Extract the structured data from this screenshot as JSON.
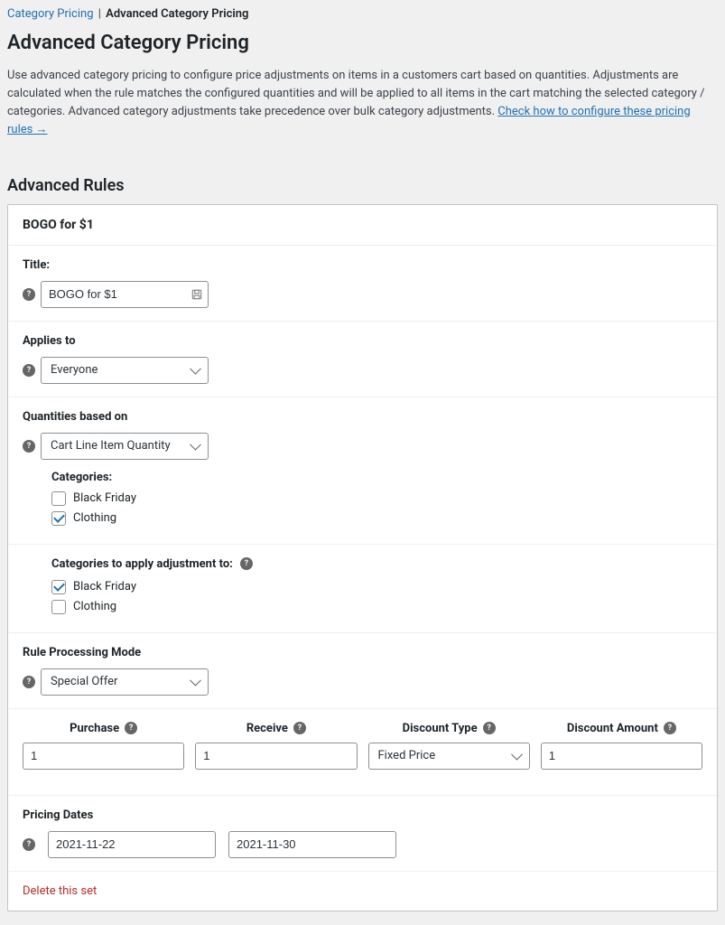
{
  "breadcrumb": {
    "link": "Category Pricing",
    "sep": "|",
    "current": "Advanced Category Pricing"
  },
  "page_title": "Advanced Category Pricing",
  "intro_text": "Use advanced category pricing to configure price adjustments on items in a customers cart based on quantities. Adjustments are calculated when the rule matches the configured quantities and will be applied to all items in the cart matching the selected category / categories. Advanced category adjustments take precedence over bulk category adjustments. ",
  "intro_link": "Check how to configure these pricing rules →",
  "rules_heading": "Advanced Rules",
  "rule": {
    "name": "BOGO for $1",
    "title_label": "Title:",
    "title_value": "BOGO for $1",
    "applies_label": "Applies to",
    "applies_value": "Everyone",
    "quantities_label": "Quantities based on",
    "quantities_value": "Cart Line Item Quantity",
    "categories_label": "Categories:",
    "categories": [
      {
        "label": "Black Friday",
        "checked": false
      },
      {
        "label": "Clothing",
        "checked": true
      }
    ],
    "apply_to_label": "Categories to apply adjustment to:",
    "apply_to_categories": [
      {
        "label": "Black Friday",
        "checked": true
      },
      {
        "label": "Clothing",
        "checked": false
      }
    ],
    "mode_label": "Rule Processing Mode",
    "mode_value": "Special Offer",
    "columns": {
      "purchase": "Purchase",
      "receive": "Receive",
      "discount_type": "Discount Type",
      "discount_amount": "Discount Amount"
    },
    "row": {
      "purchase": "1",
      "receive": "1",
      "discount_type": "Fixed Price",
      "discount_amount": "1"
    },
    "dates_label": "Pricing Dates",
    "date_from": "2021-11-22",
    "date_to": "2021-11-30",
    "delete_label": "Delete this set"
  },
  "help": "?"
}
